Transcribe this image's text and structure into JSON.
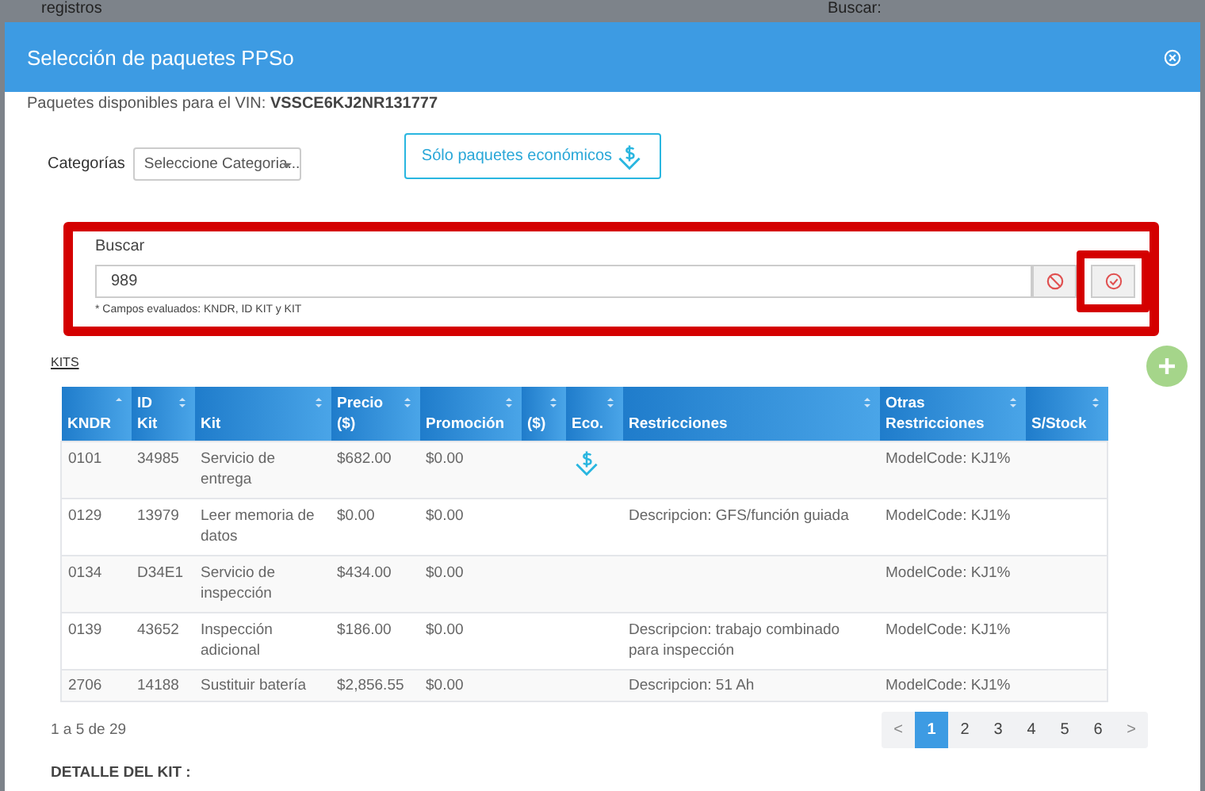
{
  "backdrop": {
    "left_text": "registros",
    "right_text": "Buscar:"
  },
  "modal": {
    "title": "Selección de paquetes PPSo"
  },
  "vin": {
    "label": "Paquetes disponibles para el VIN:",
    "value": "VSSCE6KJ2NR131777"
  },
  "categories": {
    "label": "Categorías",
    "placeholder": "Seleccione Categoria..."
  },
  "economy_button": {
    "label": "Sólo paquetes económicos"
  },
  "search": {
    "highlighted": true,
    "label": "Buscar",
    "value": "989",
    "hint": "* Campos evaluados: KNDR, ID KIT y KIT",
    "confirm_highlighted": true
  },
  "kits_link": "KITS",
  "table": {
    "columns": [
      {
        "label": "KNDR",
        "sorted": true
      },
      {
        "label": "ID\nKit",
        "sorted": false
      },
      {
        "label": "Kit",
        "sorted": false
      },
      {
        "label": "Precio\n($)",
        "sorted": false
      },
      {
        "label": "Promoción",
        "sorted": false
      },
      {
        "label": "($)",
        "sorted": false
      },
      {
        "label": "Eco.",
        "sorted": false
      },
      {
        "label": "Restricciones",
        "sorted": false
      },
      {
        "label": "Otras\nRestricciones",
        "sorted": false
      },
      {
        "label": "S/Stock",
        "sorted": false
      }
    ],
    "rows": [
      {
        "kndr": "0101",
        "id": "34985",
        "kit": "Servicio de entrega",
        "price": "$682.00",
        "promo": "$0.00",
        "eco": true,
        "other": "ModelCode: KJ1%"
      },
      {
        "kndr": "0129",
        "id": "13979",
        "kit": "Leer memoria de datos",
        "price": "$0.00",
        "promo": "$0.00",
        "eco": false,
        "restrictions": "Descripcion: GFS/función guiada",
        "other": "ModelCode: KJ1%"
      },
      {
        "kndr": "0134",
        "id": "D34E1",
        "kit": "Servicio de inspección",
        "price": "$434.00",
        "promo": "$0.00",
        "eco": false,
        "other": "ModelCode: KJ1%"
      },
      {
        "kndr": "0139",
        "id": "43652",
        "kit": "Inspección adicional",
        "price": "$186.00",
        "promo": "$0.00",
        "eco": false,
        "restrictions": "Descripcion: trabajo combinado para inspección",
        "other": "ModelCode: KJ1%"
      },
      {
        "kndr": "2706",
        "id": "14188",
        "kit": "Sustituir batería",
        "price": "$2,856.55",
        "promo": "$0.00",
        "eco": false,
        "restrictions": "Descripcion: 51 Ah",
        "other": "ModelCode: KJ1%"
      }
    ]
  },
  "summary": "1 a 5 de 29",
  "pagination": {
    "prev": "<",
    "next": ">",
    "pages": [
      {
        "label": "1",
        "selected": true
      },
      {
        "label": "2",
        "selected": false
      },
      {
        "label": "3",
        "selected": false
      },
      {
        "label": "4",
        "selected": false
      },
      {
        "label": "5",
        "selected": false
      },
      {
        "label": "6",
        "selected": false
      }
    ]
  },
  "detail_heading": "DETALLE DEL KIT :"
}
